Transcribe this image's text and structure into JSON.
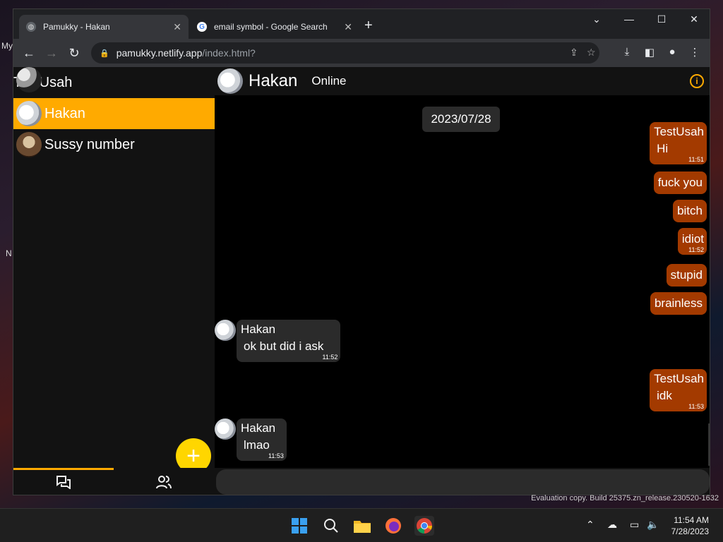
{
  "desktop": {
    "side_text": [
      "My",
      "N"
    ],
    "watermark": "Evaluation copy. Build 25375.zn_release.230520-1632"
  },
  "browser": {
    "tabs": [
      {
        "title": "Pamukky - Hakan",
        "icon": "globe-icon",
        "active": true
      },
      {
        "title": "email symbol - Google Search",
        "icon": "google-icon",
        "active": false
      }
    ],
    "url_host": "pamukky.netlify.app",
    "url_path": "/index.html?"
  },
  "app": {
    "current_user": "TestUsah",
    "chats": [
      {
        "name": "Hakan",
        "selected": true
      },
      {
        "name": "Sussy number",
        "selected": false
      }
    ],
    "chat_header": {
      "name": "Hakan",
      "status": "Online"
    },
    "date_separator": "2023/07/28",
    "messages": [
      {
        "dir": "out",
        "sender": "TestUsah",
        "text": "Hi",
        "time": "11:51"
      },
      {
        "dir": "out",
        "sender": "",
        "text": "fuck you",
        "time": ""
      },
      {
        "dir": "out",
        "sender": "",
        "text": "bitch",
        "time": ""
      },
      {
        "dir": "out",
        "sender": "",
        "text": "idiot",
        "time": "11:52"
      },
      {
        "dir": "out",
        "sender": "",
        "text": "stupid",
        "time": ""
      },
      {
        "dir": "out",
        "sender": "",
        "text": "brainless",
        "time": ""
      },
      {
        "dir": "in",
        "sender": "Hakan",
        "text": "ok but did i ask",
        "time": "11:52"
      },
      {
        "dir": "out",
        "sender": "TestUsah",
        "text": "idk",
        "time": "11:53"
      },
      {
        "dir": "in",
        "sender": "Hakan",
        "text": "lmao",
        "time": "11:53"
      }
    ],
    "accent_color": "#ffaa00",
    "outgoing_color": "#a33a00"
  },
  "taskbar": {
    "time": "11:54 AM",
    "date": "7/28/2023"
  }
}
